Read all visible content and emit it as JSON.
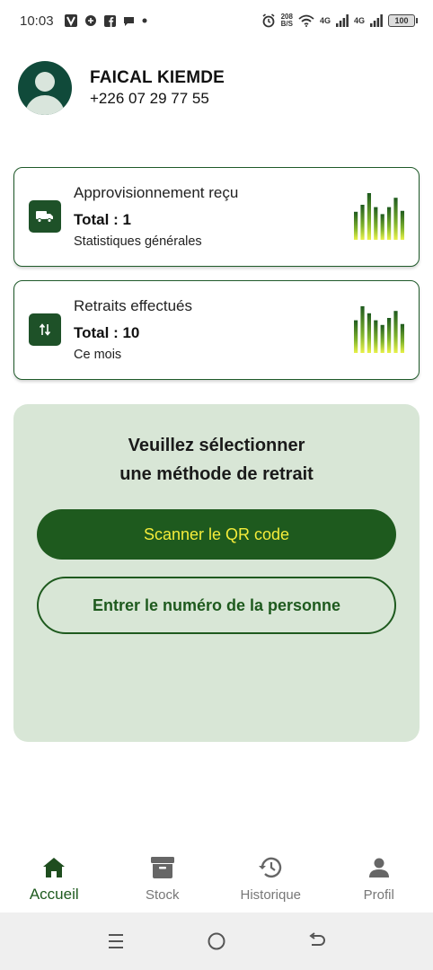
{
  "status_bar": {
    "time": "10:03",
    "net_speed_value": "208",
    "net_speed_unit": "B/S",
    "network_1": "4G",
    "network_2": "4G",
    "battery": "100"
  },
  "profile": {
    "name": "FAICAL KIEMDE",
    "phone": "+226 07 29 77 55"
  },
  "cards": [
    {
      "title": "Approvisionnement reçu",
      "total": "Total : 1",
      "subtitle": "Statistiques générales",
      "icon": "truck-icon",
      "bars": [
        0.6,
        0.75,
        1.0,
        0.7,
        0.55,
        0.7,
        0.9,
        0.62
      ]
    },
    {
      "title": "Retraits effectués",
      "total": "Total : 10",
      "subtitle": "Ce mois",
      "icon": "swap-vertical-icon",
      "bars": [
        0.7,
        1.0,
        0.85,
        0.7,
        0.6,
        0.75,
        0.9,
        0.62
      ]
    }
  ],
  "method_panel": {
    "title_line1": "Veuillez sélectionner",
    "title_line2": "une méthode de retrait",
    "scan_button": "Scanner le QR code",
    "enter_button": "Entrer le numéro de la personne"
  },
  "bottom_nav": {
    "items": [
      {
        "label": "Accueil",
        "icon": "home-icon",
        "active": true
      },
      {
        "label": "Stock",
        "icon": "archive-icon",
        "active": false
      },
      {
        "label": "Historique",
        "icon": "history-icon",
        "active": false
      },
      {
        "label": "Profil",
        "icon": "person-icon",
        "active": false
      }
    ]
  },
  "colors": {
    "primary": "#1e5a1e",
    "accent_text": "#f4ec3a",
    "panel_bg": "#d8e6d6",
    "avatar_bg": "#104a3a"
  }
}
